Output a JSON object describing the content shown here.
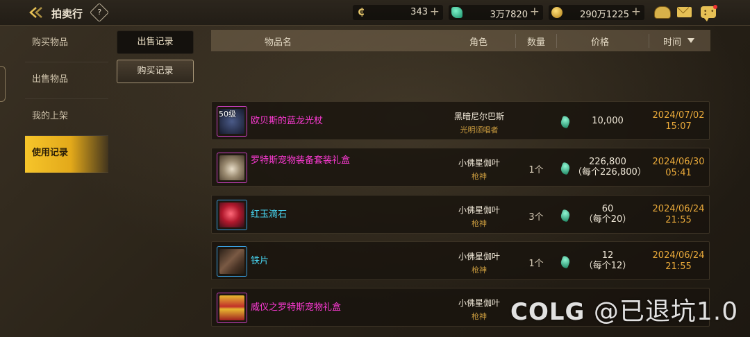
{
  "header": {
    "title": "拍卖行",
    "help": "?",
    "currencies": [
      {
        "name": "c-coin",
        "symbol": "₵",
        "value": "343"
      },
      {
        "name": "crystal",
        "value": "3万7820"
      },
      {
        "name": "gold",
        "value": "290万1225"
      }
    ],
    "plus": "+"
  },
  "nav": {
    "items": [
      {
        "label": "购买物品"
      },
      {
        "label": "出售物品"
      },
      {
        "label": "我的上架"
      },
      {
        "label": "使用记录",
        "active": true
      }
    ]
  },
  "subtabs": {
    "sell": "出售记录",
    "buy": "购买记录"
  },
  "table": {
    "headers": {
      "name": "物品名",
      "role": "角色",
      "qty": "数量",
      "price": "价格",
      "time": "时间"
    },
    "rows": [
      {
        "name": "欧贝斯的蓝龙光杖",
        "level": "50级",
        "name_color": "#ff3ad6",
        "role": "黑暗尼尔巴斯",
        "class": "光明颂唱者",
        "qty": "",
        "price": "10,000",
        "unit": "",
        "date": "2024/07/02",
        "clock": "15:07"
      },
      {
        "name": "罗特斯宠物装备套装礼盒",
        "level": "",
        "name_color": "#ff3ad6",
        "role": "小佛星伽叶",
        "class": "枪神",
        "qty": "1个",
        "price": "226,800",
        "unit": "（每个226,800）",
        "date": "2024/06/30",
        "clock": "05:41"
      },
      {
        "name": "红玉滴石",
        "level": "",
        "name_color": "#47d2ee",
        "role": "小佛星伽叶",
        "class": "枪神",
        "qty": "3个",
        "price": "60",
        "unit": "（每个20）",
        "date": "2024/06/24",
        "clock": "21:55"
      },
      {
        "name": "铁片",
        "level": "",
        "name_color": "#47d2ee",
        "role": "小佛星伽叶",
        "class": "枪神",
        "qty": "1个",
        "price": "12",
        "unit": "（每个12）",
        "date": "2024/06/24",
        "clock": "21:55"
      },
      {
        "name": "威仪之罗特斯宠物礼盒",
        "level": "",
        "name_color": "#ff3ad6",
        "role": "小佛星伽叶",
        "class": "枪神",
        "qty": "",
        "price": "",
        "unit": "",
        "date": "",
        "clock": ""
      }
    ]
  },
  "watermark": {
    "brand": "COLG",
    "text": "@已退坑1.0"
  }
}
